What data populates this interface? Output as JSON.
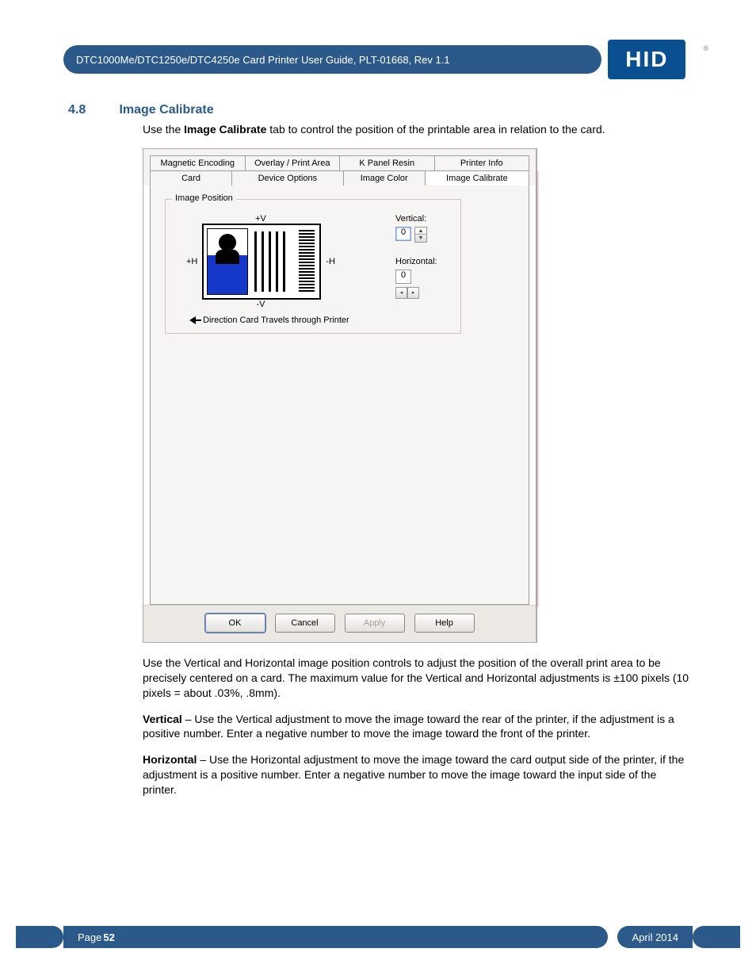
{
  "header": {
    "title": "DTC1000Me/DTC1250e/DTC4250e Card Printer User Guide, PLT-01668, Rev 1.1",
    "logo_text": "HID",
    "reg": "®"
  },
  "section": {
    "num": "4.8",
    "title": "Image Calibrate"
  },
  "intro_prefix": "Use the ",
  "intro_bold": "Image Calibrate",
  "intro_suffix": " tab to control the position of the printable area in relation to the card.",
  "dialog": {
    "tabs_row1": [
      "Magnetic Encoding",
      "Overlay / Print Area",
      "K Panel Resin",
      "Printer Info"
    ],
    "tabs_row2": [
      "Card",
      "Device Options",
      "Image Color",
      "Image Calibrate"
    ],
    "active_tab": "Image Calibrate",
    "group_title": "Image Position",
    "labels": {
      "plus_v": "+V",
      "minus_v": "-V",
      "plus_h": "+H",
      "minus_h": "-H",
      "vertical": "Vertical:",
      "horizontal": "Horizontal:",
      "direction": "Direction Card Travels through Printer"
    },
    "values": {
      "vertical": "0",
      "horizontal": "0"
    },
    "buttons": {
      "ok": "OK",
      "cancel": "Cancel",
      "apply": "Apply",
      "help": "Help"
    }
  },
  "para1": "Use the Vertical and Horizontal image position controls to adjust the position of the overall print area to be precisely centered on a card. The maximum value for the Vertical and Horizontal adjustments is ±100 pixels (10 pixels = about .03%, .8mm).",
  "para2_bold": "Vertical",
  "para2_rest": " – Use the Vertical adjustment to move the image toward the rear of the printer, if the adjustment is a positive number. Enter a negative number to move the image toward the front of the printer.",
  "para3_bold": "Horizontal",
  "para3_rest": " – Use the Horizontal adjustment to move the image toward the card output side of the printer, if the adjustment is a positive number. Enter a negative number to move the image toward the input side of the printer.",
  "footer": {
    "page_label": "Page ",
    "page_num": "52",
    "date": "April 2014"
  }
}
